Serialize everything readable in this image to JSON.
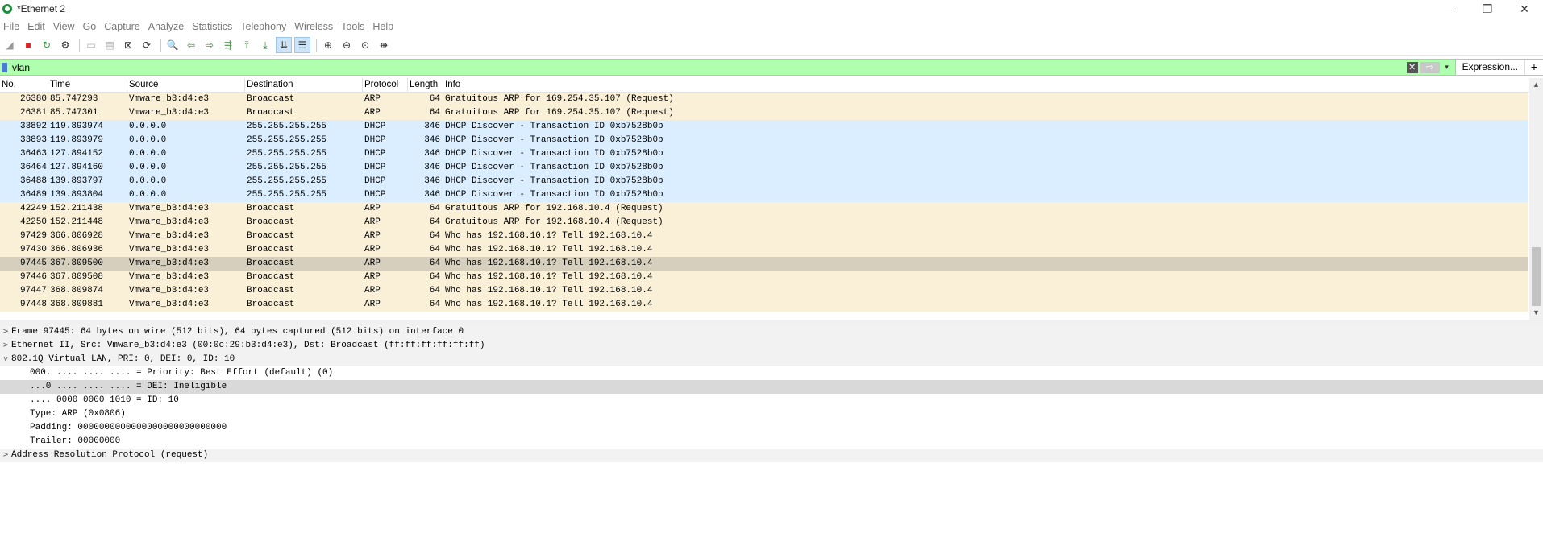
{
  "window": {
    "title": "*Ethernet 2",
    "controls": [
      "—",
      "❐",
      "✕"
    ]
  },
  "menu": [
    "File",
    "Edit",
    "View",
    "Go",
    "Capture",
    "Analyze",
    "Statistics",
    "Telephony",
    "Wireless",
    "Tools",
    "Help"
  ],
  "toolbar": {
    "icons": [
      "start-capture-icon",
      "stop-capture-icon",
      "restart-capture-icon",
      "capture-options-icon",
      "open-file-icon",
      "save-file-icon",
      "close-file-icon",
      "reload-file-icon",
      "find-packet-icon",
      "go-back-icon",
      "go-forward-icon",
      "go-to-packet-icon",
      "go-first-icon",
      "go-last-icon",
      "auto-scroll-icon",
      "colorize-icon",
      "zoom-in-icon",
      "zoom-out-icon",
      "normal-size-icon",
      "resize-columns-icon"
    ],
    "glyphs": [
      "◢",
      "■",
      "↻",
      "⚙",
      "▭",
      "▤",
      "⊠",
      "⟳",
      "🔍",
      "⇦",
      "⇨",
      "⇶",
      "⤒",
      "⤓",
      "⇊",
      "☰",
      "⊕",
      "⊖",
      "⊙",
      "⇹"
    ]
  },
  "filter": {
    "value": "vlan",
    "expression_label": "Expression...",
    "plus_label": "+",
    "clear_label": "✕",
    "apply_label": "⇨",
    "dropdown_label": "▾"
  },
  "packet_list": {
    "columns": [
      "No.",
      "Time",
      "Source",
      "Destination",
      "Protocol",
      "Length",
      "Info"
    ],
    "colors": {
      "arp": "#faf0d7",
      "dhcp": "#daeeff",
      "selected": "#d6cfbd"
    },
    "rows": [
      {
        "no": "26380",
        "time": "85.747293",
        "src": "Vmware_b3:d4:e3",
        "dst": "Broadcast",
        "proto": "ARP",
        "len": "64",
        "info": "Gratuitous ARP for 169.254.35.107 (Request)",
        "kind": "arp"
      },
      {
        "no": "26381",
        "time": "85.747301",
        "src": "Vmware_b3:d4:e3",
        "dst": "Broadcast",
        "proto": "ARP",
        "len": "64",
        "info": "Gratuitous ARP for 169.254.35.107 (Request)",
        "kind": "arp"
      },
      {
        "no": "33892",
        "time": "119.893974",
        "src": "0.0.0.0",
        "dst": "255.255.255.255",
        "proto": "DHCP",
        "len": "346",
        "info": "DHCP Discover - Transaction ID 0xb7528b0b",
        "kind": "dhcp"
      },
      {
        "no": "33893",
        "time": "119.893979",
        "src": "0.0.0.0",
        "dst": "255.255.255.255",
        "proto": "DHCP",
        "len": "346",
        "info": "DHCP Discover - Transaction ID 0xb7528b0b",
        "kind": "dhcp"
      },
      {
        "no": "36463",
        "time": "127.894152",
        "src": "0.0.0.0",
        "dst": "255.255.255.255",
        "proto": "DHCP",
        "len": "346",
        "info": "DHCP Discover - Transaction ID 0xb7528b0b",
        "kind": "dhcp"
      },
      {
        "no": "36464",
        "time": "127.894160",
        "src": "0.0.0.0",
        "dst": "255.255.255.255",
        "proto": "DHCP",
        "len": "346",
        "info": "DHCP Discover - Transaction ID 0xb7528b0b",
        "kind": "dhcp"
      },
      {
        "no": "36488",
        "time": "139.893797",
        "src": "0.0.0.0",
        "dst": "255.255.255.255",
        "proto": "DHCP",
        "len": "346",
        "info": "DHCP Discover - Transaction ID 0xb7528b0b",
        "kind": "dhcp"
      },
      {
        "no": "36489",
        "time": "139.893804",
        "src": "0.0.0.0",
        "dst": "255.255.255.255",
        "proto": "DHCP",
        "len": "346",
        "info": "DHCP Discover - Transaction ID 0xb7528b0b",
        "kind": "dhcp"
      },
      {
        "no": "42249",
        "time": "152.211438",
        "src": "Vmware_b3:d4:e3",
        "dst": "Broadcast",
        "proto": "ARP",
        "len": "64",
        "info": "Gratuitous ARP for 192.168.10.4 (Request)",
        "kind": "arp"
      },
      {
        "no": "42250",
        "time": "152.211448",
        "src": "Vmware_b3:d4:e3",
        "dst": "Broadcast",
        "proto": "ARP",
        "len": "64",
        "info": "Gratuitous ARP for 192.168.10.4 (Request)",
        "kind": "arp"
      },
      {
        "no": "97429",
        "time": "366.806928",
        "src": "Vmware_b3:d4:e3",
        "dst": "Broadcast",
        "proto": "ARP",
        "len": "64",
        "info": "Who has 192.168.10.1? Tell 192.168.10.4",
        "kind": "arp"
      },
      {
        "no": "97430",
        "time": "366.806936",
        "src": "Vmware_b3:d4:e3",
        "dst": "Broadcast",
        "proto": "ARP",
        "len": "64",
        "info": "Who has 192.168.10.1? Tell 192.168.10.4",
        "kind": "arp"
      },
      {
        "no": "97445",
        "time": "367.809500",
        "src": "Vmware_b3:d4:e3",
        "dst": "Broadcast",
        "proto": "ARP",
        "len": "64",
        "info": "Who has 192.168.10.1? Tell 192.168.10.4",
        "kind": "selected"
      },
      {
        "no": "97446",
        "time": "367.809508",
        "src": "Vmware_b3:d4:e3",
        "dst": "Broadcast",
        "proto": "ARP",
        "len": "64",
        "info": "Who has 192.168.10.1? Tell 192.168.10.4",
        "kind": "arp"
      },
      {
        "no": "97447",
        "time": "368.809874",
        "src": "Vmware_b3:d4:e3",
        "dst": "Broadcast",
        "proto": "ARP",
        "len": "64",
        "info": "Who has 192.168.10.1? Tell 192.168.10.4",
        "kind": "arp"
      },
      {
        "no": "97448",
        "time": "368.809881",
        "src": "Vmware_b3:d4:e3",
        "dst": "Broadcast",
        "proto": "ARP",
        "len": "64",
        "info": "Who has 192.168.10.1? Tell 192.168.10.4",
        "kind": "arp"
      }
    ]
  },
  "details": {
    "rows": [
      {
        "level": 0,
        "expander": ">",
        "text": "Frame 97445: 64 bytes on wire (512 bits), 64 bytes captured (512 bits) on interface 0"
      },
      {
        "level": 0,
        "expander": ">",
        "text": "Ethernet II, Src: Vmware_b3:d4:e3 (00:0c:29:b3:d4:e3), Dst: Broadcast (ff:ff:ff:ff:ff:ff)"
      },
      {
        "level": 0,
        "expander": "v",
        "text": "802.1Q Virtual LAN, PRI: 0, DEI: 0, ID: 10"
      },
      {
        "level": 1,
        "expander": "",
        "text": "000. .... .... .... = Priority: Best Effort (default) (0)"
      },
      {
        "level": 1,
        "expander": "",
        "text": "...0 .... .... .... = DEI: Ineligible",
        "selected": true
      },
      {
        "level": 1,
        "expander": "",
        "text": ".... 0000 0000 1010 = ID: 10"
      },
      {
        "level": 1,
        "expander": "",
        "text": "Type: ARP (0x0806)"
      },
      {
        "level": 1,
        "expander": "",
        "text": "Padding: 0000000000000000000000000000"
      },
      {
        "level": 1,
        "expander": "",
        "text": "Trailer: 00000000"
      },
      {
        "level": 0,
        "expander": ">",
        "text": "Address Resolution Protocol (request)"
      }
    ]
  }
}
